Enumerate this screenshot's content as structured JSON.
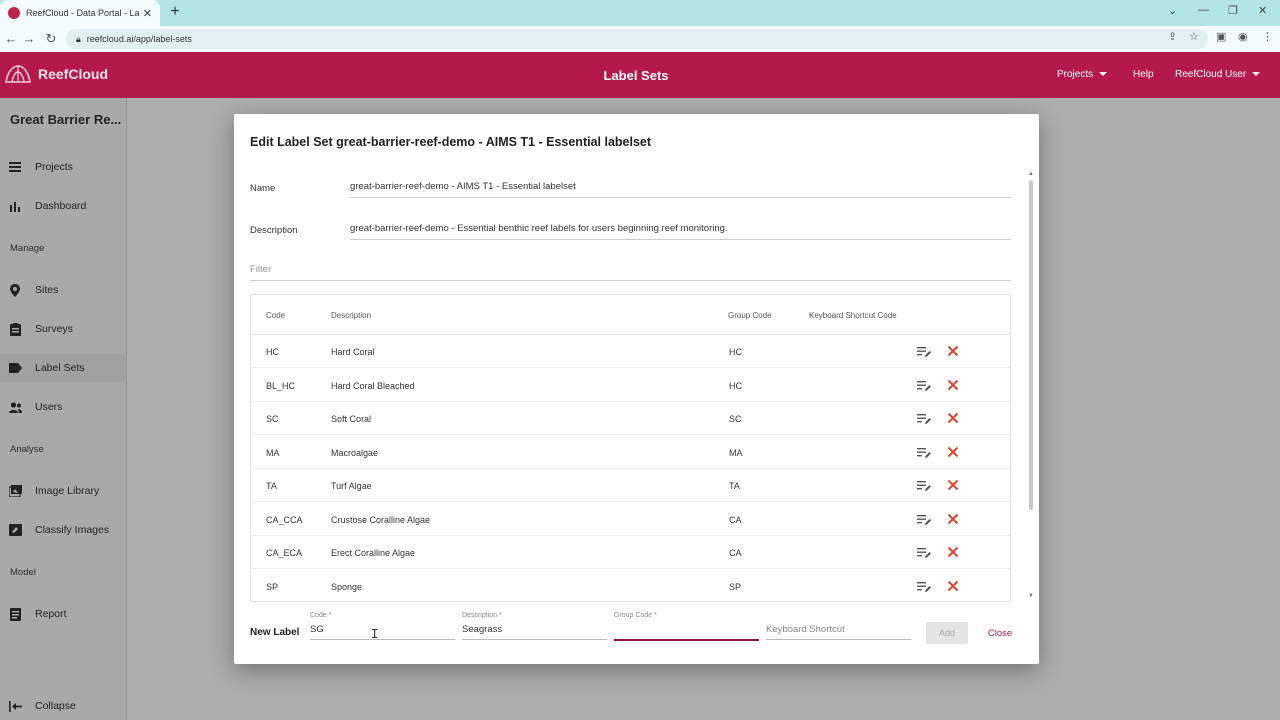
{
  "browser": {
    "tab_title": "ReefCloud - Data Portal - Label",
    "url": "reefcloud.ai/app/label-sets"
  },
  "header": {
    "logo_text": "ReefCloud",
    "page_title": "Label Sets",
    "nav": {
      "projects": "Projects",
      "help": "Help",
      "user": "ReefCloud User"
    }
  },
  "sidebar": {
    "project_title": "Great Barrier Re...",
    "items": [
      {
        "label": "Projects",
        "icon": "list-icon"
      },
      {
        "label": "Dashboard",
        "icon": "bar-chart-icon"
      },
      {
        "label": "Sites",
        "icon": "map-pin-icon"
      },
      {
        "label": "Surveys",
        "icon": "clipboard-icon"
      },
      {
        "label": "Label Sets",
        "icon": "tag-icon"
      },
      {
        "label": "Users",
        "icon": "users-icon"
      },
      {
        "label": "Image Library",
        "icon": "image-library-icon"
      },
      {
        "label": "Classify Images",
        "icon": "classify-icon"
      },
      {
        "label": "Report",
        "icon": "report-icon"
      }
    ],
    "sections": {
      "manage": "Manage",
      "analyse": "Analyse",
      "model": "Model"
    },
    "collapse": "Collapse"
  },
  "dialog": {
    "title": "Edit Label Set great-barrier-reef-demo - AIMS T1 - Essential labelset",
    "name_label": "Name",
    "name_value": "great-barrier-reef-demo - AIMS T1 - Essential labelset",
    "description_label": "Description",
    "description_value": "great-barrier-reef-demo - Essential benthic reef labels for users beginning reef monitoring.",
    "filter_placeholder": "Filter",
    "table": {
      "headers": {
        "code": "Code",
        "description": "Description",
        "group_code": "Group Code",
        "shortcut": "Keyboard Shortcut Code"
      },
      "rows": [
        {
          "code": "HC",
          "description": "Hard Coral",
          "group": "HC"
        },
        {
          "code": "BL_HC",
          "description": "Hard Coral Bleached",
          "group": "HC"
        },
        {
          "code": "SC",
          "description": "Soft Coral",
          "group": "SC"
        },
        {
          "code": "MA",
          "description": "Macroalgae",
          "group": "MA"
        },
        {
          "code": "TA",
          "description": "Turf Algae",
          "group": "TA"
        },
        {
          "code": "CA_CCA",
          "description": "Crustose Coralline Algae",
          "group": "CA"
        },
        {
          "code": "CA_ECA",
          "description": "Erect Coralline Algae",
          "group": "CA"
        },
        {
          "code": "SP",
          "description": "Sponge",
          "group": "SP"
        }
      ]
    },
    "new_label": {
      "heading": "New Label",
      "code_caption": "Code *",
      "code_value": "SG",
      "description_caption": "Description *",
      "description_value": "Seagrass",
      "group_caption": "Group Code *",
      "group_value": "",
      "shortcut_placeholder": "Keyboard Shortcut"
    },
    "add_button": "Add",
    "close_button": "Close"
  },
  "colors": {
    "brand": "#b5194a",
    "delete": "#d9482b"
  }
}
